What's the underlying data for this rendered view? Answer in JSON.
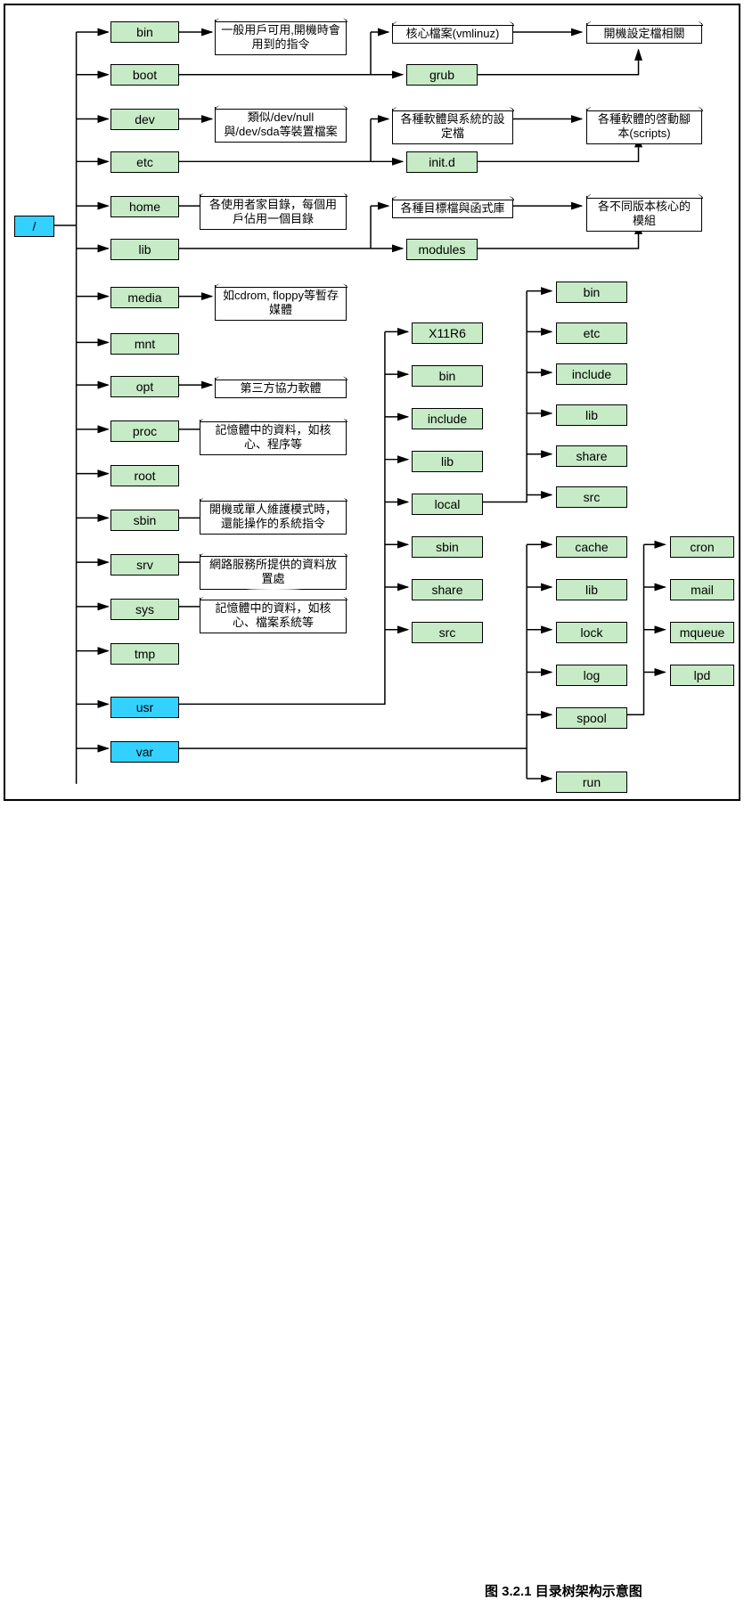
{
  "root": "/",
  "col1": {
    "bin": "bin",
    "boot": "boot",
    "dev": "dev",
    "etc": "etc",
    "home": "home",
    "lib": "lib",
    "media": "media",
    "mnt": "mnt",
    "opt": "opt",
    "proc": "proc",
    "root": "root",
    "sbin": "sbin",
    "srv": "srv",
    "sys": "sys",
    "tmp": "tmp",
    "usr": "usr",
    "var": "var"
  },
  "notes": {
    "bin": "一般用戶可用,開機時會用到的指令",
    "dev": "類似/dev/null與/dev/sda等裝置檔案",
    "home": "各使用者家目錄，每個用戶佔用一個目錄",
    "media": "如cdrom, floppy等暫存媒體",
    "opt": "第三方協力軟體",
    "proc": "記憶體中的資料，如核心、程序等",
    "sbin": "開機或單人維護模式時，還能操作的系統指令",
    "srv": "網路服務所提供的資料放置處",
    "sys": "記憶體中的資料，如核心、檔案系統等"
  },
  "col2": {
    "grub": "grub",
    "initd": "init.d",
    "modules": "modules",
    "kernel": "核心檔案(vmlinuz)",
    "etc_conf": "各種軟體與系統的設定檔",
    "targets": "各種目標檔與函式庫"
  },
  "col3": {
    "boot_conf": "開機設定檔相關",
    "scripts": "各種軟體的啓動腳本(scripts)",
    "kmod": "各不同版本核心的模組"
  },
  "usr": {
    "x11r6": "X11R6",
    "bin": "bin",
    "include": "include",
    "lib": "lib",
    "local": "local",
    "sbin": "sbin",
    "share": "share",
    "src": "src"
  },
  "local": {
    "bin": "bin",
    "etc": "etc",
    "include": "include",
    "lib": "lib",
    "share": "share",
    "src": "src"
  },
  "var": {
    "cache": "cache",
    "lib": "lib",
    "lock": "lock",
    "log": "log",
    "spool": "spool",
    "run": "run"
  },
  "spool": {
    "cron": "cron",
    "mail": "mail",
    "mqueue": "mqueue",
    "lpd": "lpd"
  },
  "caption": "图 3.2.1  目录树架构示意图"
}
